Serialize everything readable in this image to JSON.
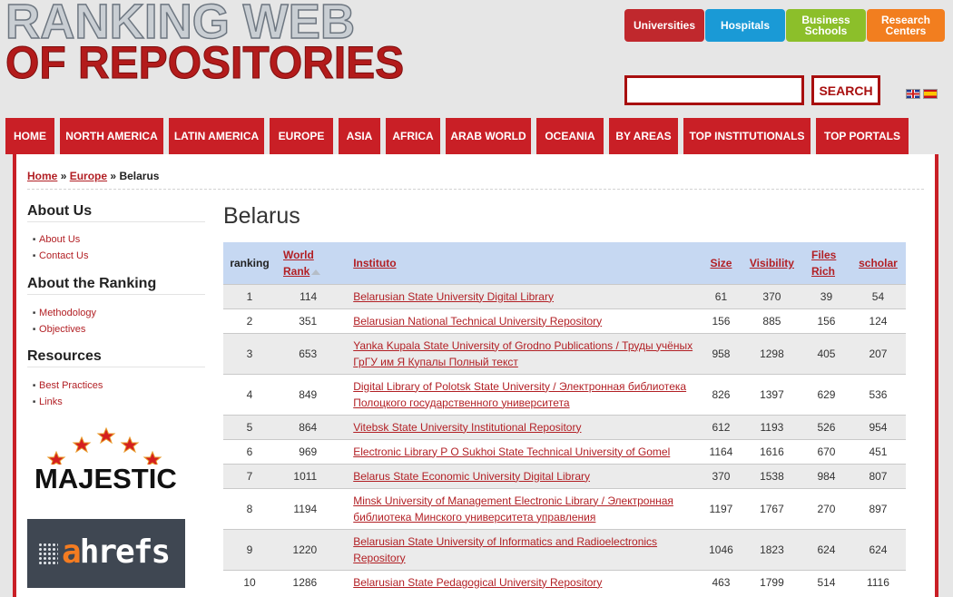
{
  "logo": {
    "line1": "RANKING WEB",
    "line2": "OF REPOSITORIES"
  },
  "categories": [
    {
      "label": "Universities",
      "color": "#c0282d"
    },
    {
      "label": "Hospitals",
      "color": "#1a9ad6"
    },
    {
      "label": "Business Schools",
      "color": "#8cbf2a"
    },
    {
      "label": "Research Centers",
      "color": "#f27e1f"
    }
  ],
  "search": {
    "value": "",
    "button_label": "SEARCH"
  },
  "nav": [
    "HOME",
    "NORTH AMERICA",
    "LATIN AMERICA",
    "EUROPE",
    "ASIA",
    "AFRICA",
    "ARAB WORLD",
    "OCEANIA",
    "BY AREAS",
    "TOP INSTITUTIONALS",
    "TOP PORTALS"
  ],
  "breadcrumb": {
    "home": "Home",
    "sep1": "»",
    "europe": "Europe",
    "sep2": "»",
    "current": "Belarus"
  },
  "sidebar": {
    "about_us": {
      "title": "About Us",
      "items": [
        "About Us",
        "Contact Us"
      ]
    },
    "about_ranking": {
      "title": "About the Ranking",
      "items": [
        "Methodology",
        "Objectives"
      ]
    },
    "resources": {
      "title": "Resources",
      "items": [
        "Best Practices",
        "Links"
      ]
    }
  },
  "sponsors": {
    "majestic": "MAJESTIC",
    "ahrefs_a": "a",
    "ahrefs_rest": "hrefs"
  },
  "page_title": "Belarus",
  "table": {
    "headers": {
      "ranking": "ranking",
      "world_rank_1": "World",
      "world_rank_2": "Rank",
      "instituto": "Instituto",
      "size": "Size",
      "visibility": "Visibility",
      "files_1": "Files",
      "files_2": "Rich",
      "scholar": "scholar"
    },
    "rows": [
      {
        "ranking": "1",
        "world": "114",
        "name": "Belarusian State University Digital Library",
        "size": "61",
        "visibility": "370",
        "files": "39",
        "scholar": "54"
      },
      {
        "ranking": "2",
        "world": "351",
        "name": "Belarusian National Technical University Repository",
        "size": "156",
        "visibility": "885",
        "files": "156",
        "scholar": "124"
      },
      {
        "ranking": "3",
        "world": "653",
        "name": "Yanka Kupala State University of Grodno Publications / Труды учёных ГрГУ им Я Купалы Полный текст",
        "size": "958",
        "visibility": "1298",
        "files": "405",
        "scholar": "207"
      },
      {
        "ranking": "4",
        "world": "849",
        "name": "Digital Library of Polotsk State University / Электронная библиотека Полоцкого государственного университета",
        "size": "826",
        "visibility": "1397",
        "files": "629",
        "scholar": "536"
      },
      {
        "ranking": "5",
        "world": "864",
        "name": "Vitebsk State University Institutional Repository",
        "size": "612",
        "visibility": "1193",
        "files": "526",
        "scholar": "954"
      },
      {
        "ranking": "6",
        "world": "969",
        "name": "Electronic Library P O Sukhoi State Technical University of Gomel",
        "size": "1164",
        "visibility": "1616",
        "files": "670",
        "scholar": "451"
      },
      {
        "ranking": "7",
        "world": "1011",
        "name": "Belarus State Economic University Digital Library",
        "size": "370",
        "visibility": "1538",
        "files": "984",
        "scholar": "807"
      },
      {
        "ranking": "8",
        "world": "1194",
        "name": "Minsk University of Management Electronic Library / Электронная библиотека Минского университета управления",
        "size": "1197",
        "visibility": "1767",
        "files": "270",
        "scholar": "897"
      },
      {
        "ranking": "9",
        "world": "1220",
        "name": "Belarusian State University of Informatics and Radioelectronics Repository",
        "size": "1046",
        "visibility": "1823",
        "files": "624",
        "scholar": "624"
      },
      {
        "ranking": "10",
        "world": "1286",
        "name": "Belarusian State Pedagogical University Repository",
        "size": "463",
        "visibility": "1799",
        "files": "514",
        "scholar": "1116"
      }
    ]
  }
}
